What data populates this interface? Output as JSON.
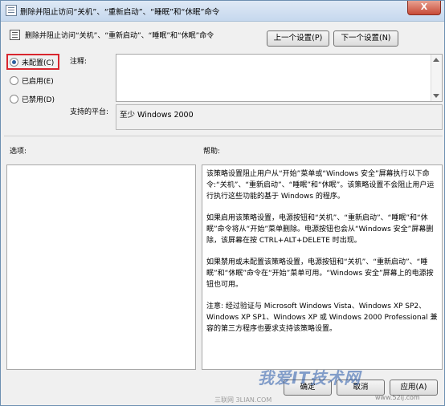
{
  "window": {
    "title": "删除并阻止访问“关机”、“重新启动”、“睡眠”和“休眠”命令",
    "close_glyph": "X"
  },
  "policy": {
    "title": "删除并阻止访问“关机”、“重新启动”、“睡眠”和“休眠”命令"
  },
  "nav": {
    "prev_label": "上一个设置(P)",
    "next_label": "下一个设置(N)"
  },
  "state": {
    "options": [
      {
        "label": "未配置(C)",
        "checked": true
      },
      {
        "label": "已启用(E)",
        "checked": false
      },
      {
        "label": "已禁用(D)",
        "checked": false
      }
    ]
  },
  "comment": {
    "label": "注释:",
    "value": ""
  },
  "platform": {
    "label": "支持的平台:",
    "value": "至少 Windows 2000"
  },
  "sections": {
    "options_label": "选项:",
    "help_label": "帮助:"
  },
  "help": {
    "paragraphs": [
      "该策略设置阻止用户从“开始”菜单或“Windows 安全”屏幕执行以下命令:“关机”、“重新启动”、“睡眠”和“休眠”。该策略设置不会阻止用户运行执行这些功能的基于 Windows 的程序。",
      "如果启用该策略设置，电源按钮和“关机”、“重新启动”、“睡眠”和“休眠”命令将从“开始”菜单删除。电源按钮也会从“Windows 安全”屏幕删除，该屏幕在按 CTRL+ALT+DELETE 时出现。",
      "如果禁用或未配置该策略设置，电源按钮和“关机”、“重新启动”、“睡眠”和“休眠”命令在“开始”菜单可用。“Windows 安全”屏幕上的电源按钮也可用。",
      "注意: 经过验证与 Microsoft Windows Vista、Windows XP SP2、Windows XP SP1、Windows XP 或 Windows 2000 Professional 兼容的第三方程序也要求支持该策略设置。"
    ]
  },
  "footer": {
    "ok_label": "确定",
    "cancel_label": "取消",
    "apply_label": "应用(A)"
  },
  "watermark": {
    "text": "我爱IT技术网",
    "url": "www.52ij.com",
    "left_text": "三联网 3LIAN.COM"
  },
  "colors": {
    "highlight_border": "#d9262e",
    "titlebar": "#c6d8ee"
  }
}
